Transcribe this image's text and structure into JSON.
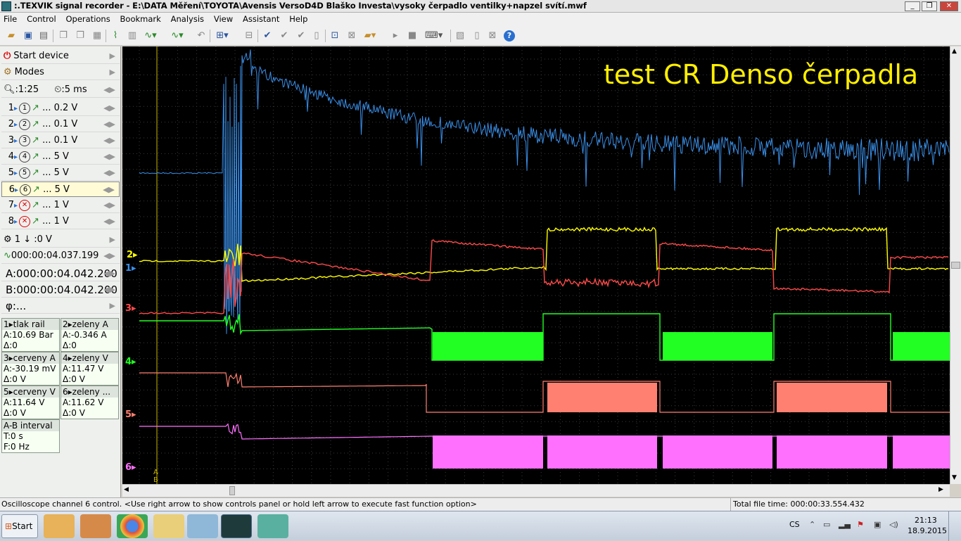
{
  "window": {
    "title": ":.TEXVIK  signal recorder - E:\\DATA Měření\\TOYOTA\\Avensis VersoD4D Blaško Investa\\vysoky čerpadlo ventilky+napzel svítí.mwf",
    "min_label": "_",
    "max_label": "❐",
    "close_label": "✕"
  },
  "menu": [
    "File",
    "Control",
    "Operations",
    "Bookmark",
    "Analysis",
    "View",
    "Assistant",
    "Help"
  ],
  "left_panel": {
    "start_device": "Start device",
    "modes": "Modes",
    "zoom": ":1:25",
    "timebase": ":5 ms",
    "channels": [
      {
        "num": "1",
        "icon": "1",
        "scale": "... 0.2 V"
      },
      {
        "num": "2",
        "icon": "2",
        "scale": "... 0.1 V"
      },
      {
        "num": "3",
        "icon": "3",
        "scale": "... 0.1 V"
      },
      {
        "num": "4",
        "icon": "4",
        "scale": "... 5 V"
      },
      {
        "num": "5",
        "icon": "5",
        "scale": "... 5 V"
      },
      {
        "num": "6",
        "icon": "6",
        "scale": "... 5 V"
      },
      {
        "num": "7",
        "icon": "✕",
        "scale": "... 1 V"
      },
      {
        "num": "8",
        "icon": "✕",
        "scale": "... 1 V"
      }
    ],
    "trigger": "1 ↓ :0 V",
    "time": "000:00:04.037.199",
    "cursor_a": "A:000:00:04.042.200",
    "cursor_b": "B:000:00:04.042.200",
    "phi": "φ:...",
    "measurements": [
      {
        "name": "1▸tlak rail",
        "a": "A:10.69 Bar",
        "d": "Δ:0"
      },
      {
        "name": "2▸zeleny A",
        "a": "A:-0.346 A",
        "d": "Δ:0"
      },
      {
        "name": "3▸cerveny A",
        "a": "A:-30.19 mV",
        "d": "Δ:0 V"
      },
      {
        "name": "4▸zeleny V",
        "a": "A:11.47 V",
        "d": "Δ:0 V"
      },
      {
        "name": "5▸cerveny V",
        "a": "A:11.64 V",
        "d": "Δ:0 V"
      },
      {
        "name": "6▸zeleny ...",
        "a": "A:11.62 V",
        "d": "Δ:0 V"
      }
    ],
    "interval": {
      "title": "A-B interval",
      "t": "T:0 s",
      "f": "F:0 Hz"
    }
  },
  "scope": {
    "overlay_text": "test CR Denso čerpadla",
    "channel_markers": [
      "2▸",
      "1▸",
      "3▸",
      "4▸",
      "5▸",
      "6▸"
    ],
    "cursor_labels": [
      "A",
      "B"
    ],
    "colors": {
      "ch1": "#3a8fe8",
      "ch2": "#ffff00",
      "ch3": "#ff4a4a",
      "ch4": "#22ff22",
      "ch5": "#ff8070",
      "ch6": "#ff70ff",
      "grid": "#3a3a3a",
      "cursor": "#c8b400"
    }
  },
  "status": {
    "message": "Oscilloscope channel 6 control.  <Use right arrow to show controls panel or hold left arrow to execute fast function option>",
    "total_time": "Total file time: 000:00:33.554.432"
  },
  "taskbar": {
    "start": "Start",
    "lang": "CS",
    "time": "21:13",
    "date": "18.9.2015"
  }
}
